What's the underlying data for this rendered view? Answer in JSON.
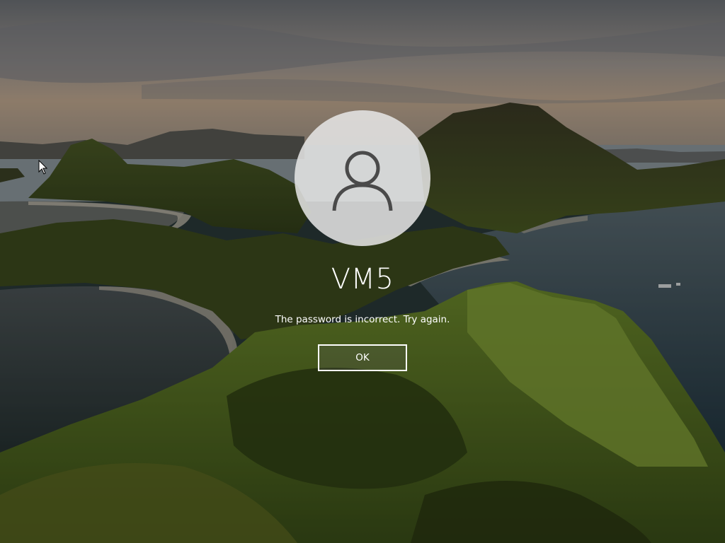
{
  "lock_screen": {
    "user_name": "VM5",
    "error_message": "The password is incorrect. Try again.",
    "ok_button_label": "OK",
    "avatar_icon": "user-silhouette-icon",
    "cursor_icon": "mouse-pointer-icon"
  },
  "colors": {
    "text": "#ffffff",
    "avatar_bg": "#e6e6e6",
    "avatar_glyph": "#4a4a4a"
  }
}
